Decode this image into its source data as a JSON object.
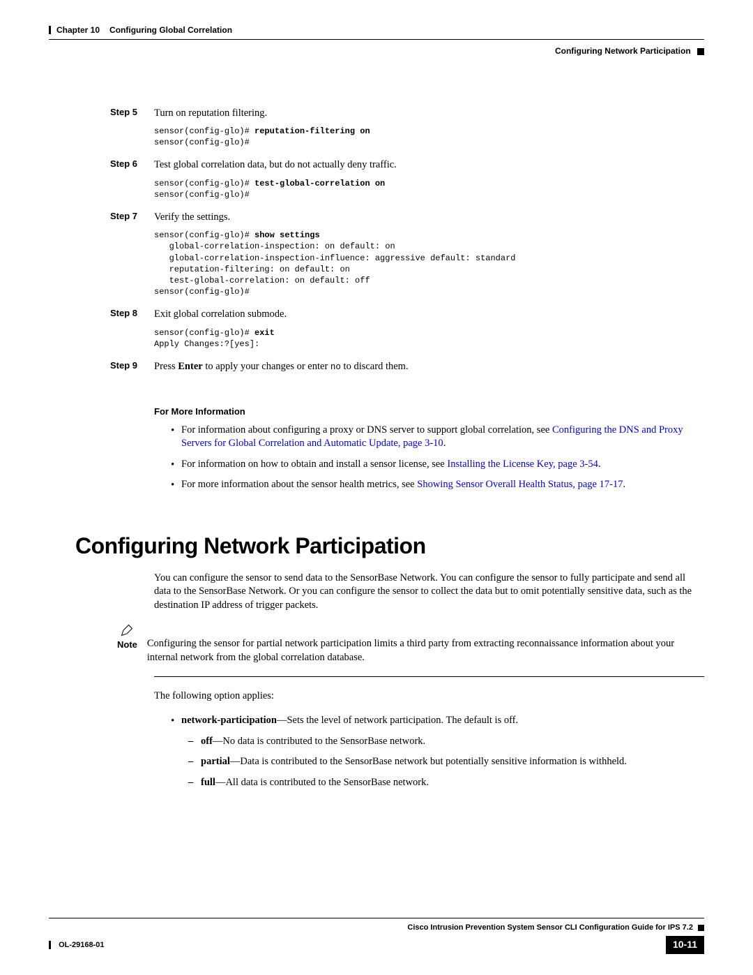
{
  "header": {
    "chapter": "Chapter 10",
    "chapter_title": "Configuring Global Correlation",
    "section": "Configuring Network Participation"
  },
  "steps": {
    "s5": {
      "label": "Step 5",
      "text": "Turn on reputation filtering."
    },
    "s5_code_pre": "sensor(config-glo)# ",
    "s5_code_bold": "reputation-filtering on",
    "s5_code_line2": "sensor(config-glo)#",
    "s6": {
      "label": "Step 6",
      "text": "Test global correlation data, but do not actually deny traffic."
    },
    "s6_code_pre": "sensor(config-glo)# ",
    "s6_code_bold": "test-global-correlation on",
    "s6_code_line2": "sensor(config-glo)#",
    "s7": {
      "label": "Step 7",
      "text": "Verify the settings."
    },
    "s7_code_pre": "sensor(config-glo)# ",
    "s7_code_bold": "show settings",
    "s7_code_body": "   global-correlation-inspection: on default: on\n   global-correlation-inspection-influence: aggressive default: standard\n   reputation-filtering: on default: on\n   test-global-correlation: on default: off\nsensor(config-glo)#",
    "s8": {
      "label": "Step 8",
      "text": "Exit global correlation submode."
    },
    "s8_code_pre": "sensor(config-glo)# ",
    "s8_code_bold": "exit",
    "s8_code_line2": "Apply Changes:?[yes]:",
    "s9": {
      "label": "Step 9",
      "pre": "Press ",
      "enter": "Enter",
      "mid": " to apply your changes or enter ",
      "no": "no",
      "post": " to discard them."
    }
  },
  "for_more": {
    "heading": "For More Information",
    "i1_pre": "For information about configuring a proxy or DNS server to support global correlation, see ",
    "i1_link": "Configuring the DNS and Proxy Servers for Global Correlation and Automatic Update, page 3-10",
    "i1_post": ".",
    "i2_pre": "For information on how to obtain and install a sensor license, see ",
    "i2_link": "Installing the License Key, page 3-54",
    "i2_post": ".",
    "i3_pre": "For more information about the sensor health metrics, see ",
    "i3_link": "Showing Sensor Overall Health Status, page 17-17",
    "i3_post": "."
  },
  "section2": {
    "heading": "Configuring Network Participation",
    "intro": "You can configure the sensor to send data to the SensorBase Network. You can configure the sensor to fully participate and send all data to the SensorBase Network. Or you can configure the sensor to collect the data but to omit potentially sensitive data, such as the destination IP address of trigger packets.",
    "note_label": "Note",
    "note_text": "Configuring the sensor for partial network participation limits a third party from extracting reconnaissance information about your internal network from the global correlation database.",
    "following": "The following option applies:",
    "opt_bold": "network-participation",
    "opt_rest": "—Sets the level of network participation. The default is off.",
    "sub_off_bold": "off",
    "sub_off_rest": "—No data is contributed to the SensorBase network.",
    "sub_partial_bold": "partial",
    "sub_partial_rest": "—Data is contributed to the SensorBase network but potentially sensitive information is withheld.",
    "sub_full_bold": "full",
    "sub_full_rest": "—All data is contributed to the SensorBase network."
  },
  "footer": {
    "guide": "Cisco Intrusion Prevention System Sensor CLI Configuration Guide for IPS 7.2",
    "doc_id": "OL-29168-01",
    "page": "10-11"
  }
}
